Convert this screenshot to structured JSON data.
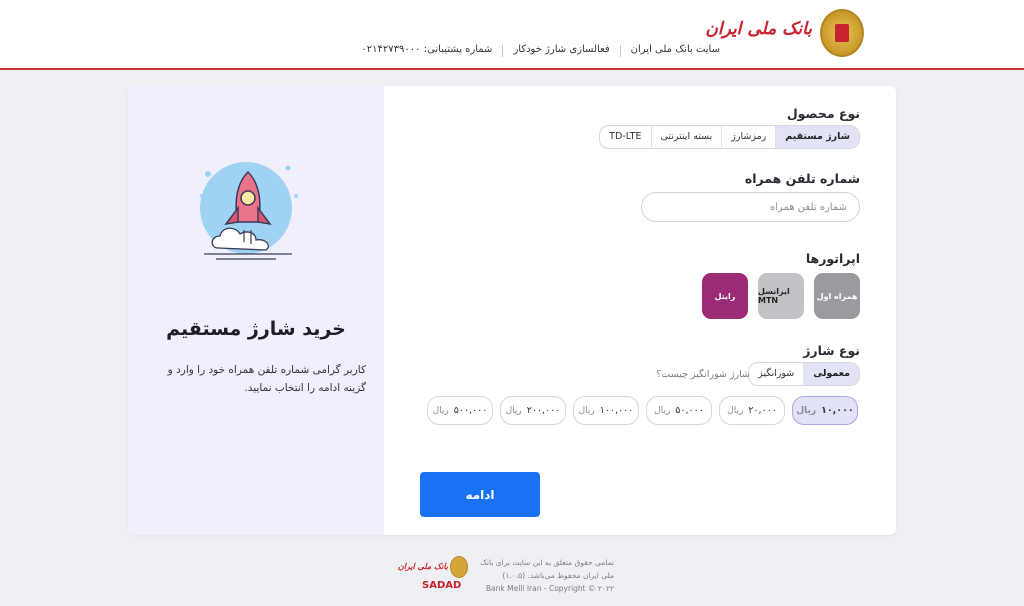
{
  "header": {
    "logo_text": "بانک ملی ایران",
    "nav": [
      {
        "label": "سایت بانک ملی ایران"
      },
      {
        "label": "فعالسازی شارژ خودکار"
      },
      {
        "label": "شماره پشتیبانی: ۰۲۱۴۲۷۳۹۰۰۰"
      }
    ]
  },
  "intro": {
    "title": "خرید شارژ مستقیم",
    "description": "کاربر گرامی شماره تلفن همراه خود را وارد و گزینه ادامه را انتخاب نمایید."
  },
  "form": {
    "product_label": "نوع محصول",
    "product_options": [
      "شارژ مستقیم",
      "رمزشارژ",
      "بسته اینترنتی",
      "TD-LTE"
    ],
    "product_selected": "شارژ مستقیم",
    "phone_label": "شماره تلفن همراه",
    "phone_value": "",
    "phone_placeholder": "شماره تلفن همراه",
    "operators_label": "اپراتورها",
    "operators": [
      {
        "name": "همراه اول",
        "mark": "همراه اول",
        "color": "#9a9ba0"
      },
      {
        "name": "ایرانسل",
        "mark": "ایرانسل MTN",
        "color": "#c2c2c6"
      },
      {
        "name": "رایتل",
        "mark": "رایتل",
        "color": "#9b2b77"
      }
    ],
    "charge_type_label": "نوع شارژ",
    "charge_types": [
      "معمولی",
      "شورانگیز"
    ],
    "charge_type_selected": "معمولی",
    "help_link": "شارژ شورانگیز چیست؟",
    "currency": "ریال",
    "amounts": [
      "۱۰,۰۰۰",
      "۲۰,۰۰۰",
      "۵۰,۰۰۰",
      "۱۰۰,۰۰۰",
      "۲۰۰,۰۰۰",
      "۵۰۰,۰۰۰"
    ],
    "amount_selected": "۱۰,۰۰۰",
    "continue_label": "ادامه"
  },
  "footer": {
    "logo_text": "بانک ملی ایران",
    "brand": "SADAD",
    "rights": "تمامی حقوق متعلق به این سایت برای بانک ملی ایران محفوظ می‌باشد. (۱.۰.۵)",
    "copyright": "Bank Melli Iran - Copyright © ۲۰۲۲"
  },
  "colors": {
    "accent": "#1971f5",
    "brand_red": "#c8232c",
    "selected_bg": "#e3e3f7",
    "panel_bg": "#f0f0fc"
  }
}
